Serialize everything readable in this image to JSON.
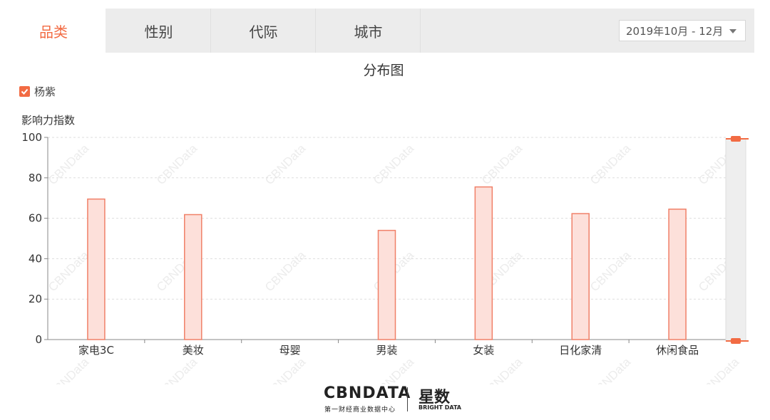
{
  "tabs": [
    {
      "label": "品类",
      "active": true
    },
    {
      "label": "性别",
      "active": false
    },
    {
      "label": "代际",
      "active": false
    },
    {
      "label": "城市",
      "active": false
    }
  ],
  "date_range": "2019年10月 - 12月",
  "colors": {
    "accent": "#f26b43",
    "bar_fill": "#fde0da",
    "bar_stroke": "#f08068"
  },
  "chart_data": {
    "type": "bar",
    "title": "分布图",
    "ylabel": "影响力指数",
    "xlabel": "",
    "categories": [
      "家电3C",
      "美妆",
      "母婴",
      "男装",
      "女装",
      "日化家清",
      "休闲食品"
    ],
    "series": [
      {
        "name": "杨紫",
        "values": [
          69.5,
          61.8,
          0,
          54,
          75.5,
          62.3,
          64.5
        ]
      }
    ],
    "ylim": [
      0,
      100
    ],
    "yticks": [
      0,
      20,
      40,
      60,
      80,
      100
    ],
    "grid": true,
    "legend": "top-left",
    "watermark": "CBNData"
  },
  "footer": {
    "brand": "CBNDATA",
    "brand_sub": "第一财经商业数据中心",
    "partner": "星数",
    "partner_sub": "BRIGHT DATA"
  }
}
